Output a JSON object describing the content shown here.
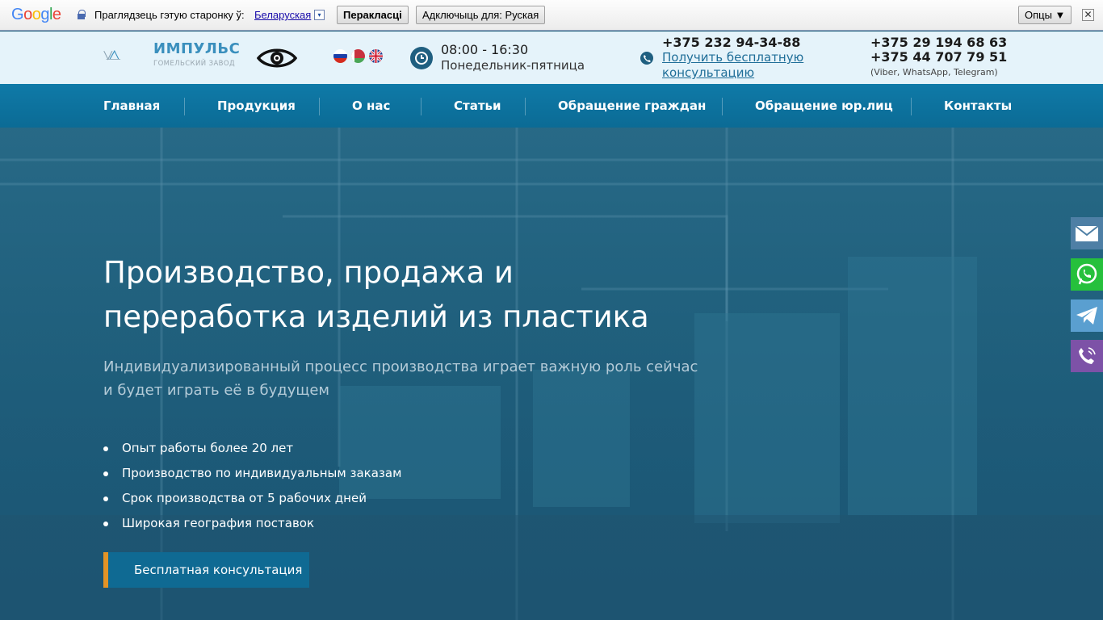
{
  "translate_bar": {
    "logo": "Google",
    "prompt": "Праглядзець гэтую старонку ў:",
    "language": "Беларуская",
    "dropdown_arrow": "▾",
    "translate_button": "Перакласці",
    "turn_off_button": "Адключыць для: Руская",
    "options_button": "Опцы ▼",
    "close_button": "✕"
  },
  "header": {
    "logo": {
      "name": "ИМПУЛЬС",
      "subtitle": "Гомельский завод"
    },
    "accessibility_icon": "eye-icon",
    "language_flags": [
      "flag-ru",
      "flag-by",
      "flag-uk"
    ],
    "hours": {
      "icon": "clock-icon",
      "time": "08:00 - 16:30",
      "days": "Понедельник-пятница"
    },
    "phone_main": "+375 232 94-34-88",
    "consult_link": "Получить бесплатную консультацию",
    "phone_mobile_1": "+375 29 194 68 63",
    "phone_mobile_2": "+375 44 707 79 51",
    "messengers_note": "(Viber, WhatsApp, Telegram)"
  },
  "nav": {
    "items": [
      {
        "label": "Главная"
      },
      {
        "label": "Продукция"
      },
      {
        "label": "О нас"
      },
      {
        "label": "Статьи"
      },
      {
        "label": "Обращение граждан"
      },
      {
        "label": "Обращение юр.лиц"
      },
      {
        "label": "Контакты"
      }
    ]
  },
  "hero": {
    "title": "Производство, продажа и переработка изделий из пластика",
    "subtitle": "Индивидуализированный процесс производства играет важную роль сейчас и будет играть её в будущем",
    "bullets": [
      "Опыт работы более 20 лет",
      "Производство по индивидуальным заказам",
      "Срок производства от 5 рабочих дней",
      "Широкая география поставок"
    ],
    "cta": "Бесплатная консультация"
  },
  "side_contacts": [
    "mail-icon",
    "whatsapp-icon",
    "telegram-icon",
    "viber-icon"
  ],
  "colors": {
    "nav_bg": "#0f7aa8",
    "header_bg": "#e5f3fa",
    "cta_accent": "#e39426",
    "whatsapp": "#26c03c",
    "telegram": "#5a9fd0",
    "viber": "#7d52a7",
    "mail": "#4e7fa5"
  }
}
